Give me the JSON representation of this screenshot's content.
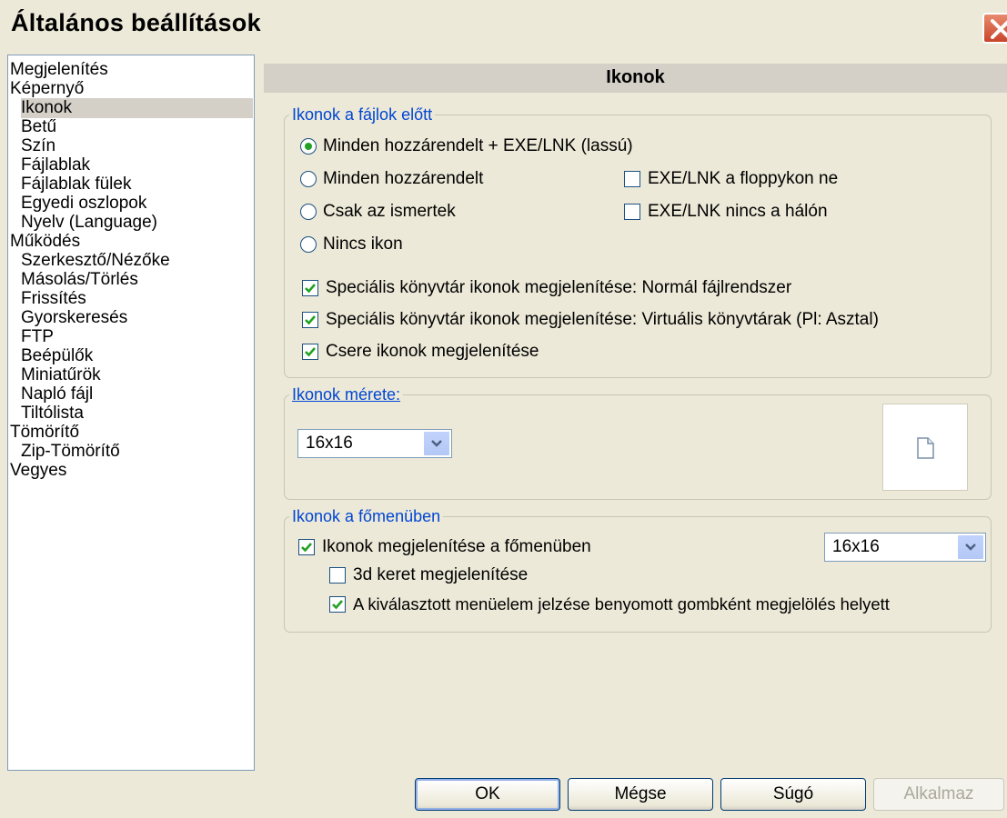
{
  "window": {
    "title": "Általános beállítások"
  },
  "tree": {
    "items": [
      {
        "label": "Megjelenítés",
        "level": 0,
        "selected": false
      },
      {
        "label": "Képernyő",
        "level": 0,
        "selected": false
      },
      {
        "label": "Ikonok",
        "level": 1,
        "selected": true
      },
      {
        "label": "Betű",
        "level": 1,
        "selected": false
      },
      {
        "label": "Szín",
        "level": 1,
        "selected": false
      },
      {
        "label": "Fájlablak",
        "level": 1,
        "selected": false
      },
      {
        "label": "Fájlablak fülek",
        "level": 1,
        "selected": false
      },
      {
        "label": "Egyedi oszlopok",
        "level": 1,
        "selected": false
      },
      {
        "label": "Nyelv (Language)",
        "level": 1,
        "selected": false
      },
      {
        "label": "Működés",
        "level": 0,
        "selected": false
      },
      {
        "label": "Szerkesztő/Nézőke",
        "level": 1,
        "selected": false
      },
      {
        "label": "Másolás/Törlés",
        "level": 1,
        "selected": false
      },
      {
        "label": "Frissítés",
        "level": 1,
        "selected": false
      },
      {
        "label": "Gyorskeresés",
        "level": 1,
        "selected": false
      },
      {
        "label": "FTP",
        "level": 1,
        "selected": false
      },
      {
        "label": "Beépülők",
        "level": 1,
        "selected": false
      },
      {
        "label": "Miniatűrök",
        "level": 1,
        "selected": false
      },
      {
        "label": "Napló fájl",
        "level": 1,
        "selected": false
      },
      {
        "label": "Tiltólista",
        "level": 1,
        "selected": false
      },
      {
        "label": "Tömörítő",
        "level": 0,
        "selected": false
      },
      {
        "label": "Zip-Tömörítő",
        "level": 1,
        "selected": false
      },
      {
        "label": "Vegyes",
        "level": 0,
        "selected": false
      }
    ]
  },
  "panel": {
    "header": "Ikonok"
  },
  "group_icons": {
    "legend": "Ikonok a fájlok előtt",
    "radios": [
      {
        "label": "Minden hozzárendelt + EXE/LNK (lassú)",
        "checked": true
      },
      {
        "label": "Minden hozzárendelt",
        "checked": false
      },
      {
        "label": "Csak az ismertek",
        "checked": false
      },
      {
        "label": "Nincs ikon",
        "checked": false
      }
    ],
    "side_checks": [
      {
        "label": "EXE/LNK a floppykon ne",
        "checked": false
      },
      {
        "label": "EXE/LNK nincs a hálón",
        "checked": false
      }
    ],
    "checks": [
      {
        "label": "Speciális könyvtár ikonok megjelenítése: Normál fájlrendszer",
        "checked": true
      },
      {
        "label": "Speciális könyvtár ikonok megjelenítése: Virtuális könyvtárak (Pl: Asztal)",
        "checked": true
      },
      {
        "label": "Csere ikonok megjelenítése",
        "checked": true
      }
    ]
  },
  "group_size": {
    "legend": "Ikonok mérete:",
    "select_value": "16x16",
    "preview_icon": "document-icon"
  },
  "group_menu": {
    "legend": "Ikonok a főmenüben",
    "show_icons": {
      "label": "Ikonok megjelenítése a főmenüben",
      "checked": true
    },
    "select_value": "16x16",
    "frame_3d": {
      "label": "3d keret megjelenítése",
      "checked": false
    },
    "pressed": {
      "label": "A kiválasztott menüelem jelzése benyomott gombként megjelölés helyett",
      "checked": true
    }
  },
  "buttons": {
    "ok": "OK",
    "cancel": "Mégse",
    "help": "Súgó",
    "apply": "Alkalmaz"
  },
  "colors": {
    "accent_legend": "#0046d5",
    "check": "#21a121",
    "close": "#c8452a"
  }
}
